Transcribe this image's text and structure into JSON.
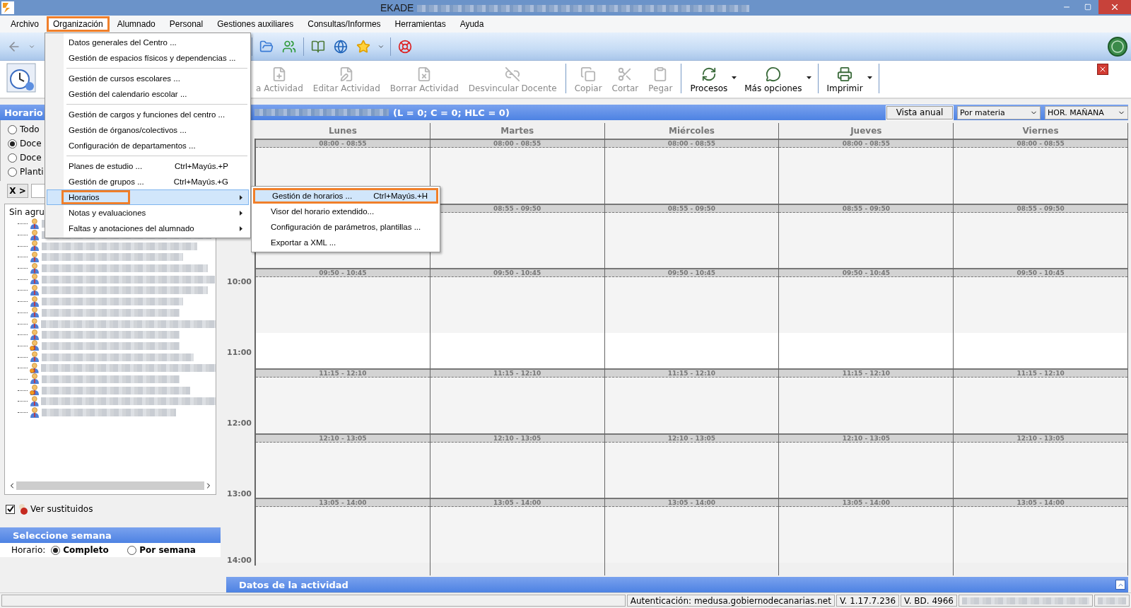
{
  "window": {
    "title": "EKADE"
  },
  "menu_bar": [
    {
      "label": "Archivo",
      "selected": false
    },
    {
      "label": "Organización",
      "selected": true
    },
    {
      "label": "Alumnado",
      "selected": false
    },
    {
      "label": "Personal",
      "selected": false
    },
    {
      "label": "Gestiones auxiliares",
      "selected": false
    },
    {
      "label": "Consultas/Informes",
      "selected": false
    },
    {
      "label": "Herramientas",
      "selected": false
    },
    {
      "label": "Ayuda",
      "selected": false
    }
  ],
  "dropdown": {
    "groups": [
      [
        {
          "label": "Datos generales del Centro ...",
          "selected": false,
          "outlined": false,
          "submenu": false
        },
        {
          "label": "Gestión de espacios físicos y dependencias ...",
          "selected": false,
          "outlined": false,
          "submenu": false
        }
      ],
      [
        {
          "label": "Gestión de cursos escolares ...",
          "selected": false,
          "outlined": false,
          "submenu": false
        },
        {
          "label": "Gestión del calendario escolar ...",
          "selected": false,
          "outlined": false,
          "submenu": false
        }
      ],
      [
        {
          "label": "Gestión de cargos y funciones del centro ...",
          "selected": false,
          "outlined": false,
          "submenu": false
        },
        {
          "label": "Gestión de órganos/colectivos ...",
          "selected": false,
          "outlined": false,
          "submenu": false
        },
        {
          "label": "Configuración de departamentos ...",
          "selected": false,
          "outlined": false,
          "submenu": false
        }
      ],
      [
        {
          "label": "Planes de estudio ...",
          "shortcut": "Ctrl+Mayús.+P",
          "selected": false,
          "outlined": false,
          "submenu": false
        },
        {
          "label": "Gestión de grupos ...",
          "shortcut": "Ctrl+Mayús.+G",
          "selected": false,
          "outlined": false,
          "submenu": false
        },
        {
          "label": "Horarios",
          "selected": true,
          "outlined": true,
          "submenu": true
        },
        {
          "label": "Notas y evaluaciones",
          "selected": false,
          "outlined": false,
          "submenu": true
        },
        {
          "label": "Faltas y anotaciones del alumnado",
          "selected": false,
          "outlined": false,
          "submenu": true
        }
      ]
    ]
  },
  "submenu": [
    {
      "label": "Gestión de horarios ...",
      "shortcut": "Ctrl+Mayús.+H",
      "selected": true,
      "outlined": true
    },
    {
      "label": "Visor del horario extendido...",
      "selected": false,
      "outlined": false
    },
    {
      "label": "Configuración de parámetros, plantillas ...",
      "selected": false,
      "outlined": false
    },
    {
      "label": "Exportar a XML ...",
      "selected": false,
      "outlined": false
    }
  ],
  "ribbon": {
    "groups": [
      [
        {
          "label": "a Actividad",
          "disabled": true,
          "dropdown": false
        },
        {
          "label": "Editar Actividad",
          "disabled": true,
          "dropdown": false
        },
        {
          "label": "Borrar Actividad",
          "disabled": true,
          "dropdown": false
        },
        {
          "label": "Desvincular Docente",
          "disabled": true,
          "dropdown": false
        }
      ],
      [
        {
          "label": "Copiar",
          "disabled": true,
          "dropdown": false
        },
        {
          "label": "Cortar",
          "disabled": true,
          "dropdown": false
        },
        {
          "label": "Pegar",
          "disabled": true,
          "dropdown": false
        }
      ],
      [
        {
          "label": "Procesos",
          "disabled": false,
          "dropdown": true
        },
        {
          "label": "Más opciones",
          "disabled": false,
          "dropdown": true
        }
      ],
      [
        {
          "label": "Imprimir",
          "disabled": false,
          "dropdown": true
        }
      ]
    ]
  },
  "left_panel": {
    "title": "Horario",
    "radios": [
      {
        "label": "Todo",
        "selected": false
      },
      {
        "label": "Doce",
        "selected": true
      },
      {
        "label": "Doce",
        "selected": false
      },
      {
        "label": "Planti",
        "selected": false
      }
    ],
    "filter_button": "X >",
    "tree_root": "Sin agru",
    "tree_items": [
      {
        "kind": "teacher"
      },
      {
        "kind": "teacher"
      },
      {
        "kind": "teacher"
      },
      {
        "kind": "teacher"
      },
      {
        "kind": "teacher"
      },
      {
        "kind": "teacher"
      },
      {
        "kind": "teacher"
      },
      {
        "kind": "teacher"
      },
      {
        "kind": "teacher"
      },
      {
        "kind": "teacher"
      },
      {
        "kind": "teacher"
      },
      {
        "kind": "marked"
      },
      {
        "kind": "teacher"
      },
      {
        "kind": "marked"
      },
      {
        "kind": "teacher"
      },
      {
        "kind": "marked"
      },
      {
        "kind": "teacher"
      },
      {
        "kind": "teacher"
      }
    ],
    "show_substitutes": {
      "label": "Ver sustituidos",
      "checked": true
    }
  },
  "week_panel": {
    "title": "Seleccione semana",
    "label": "Horario:",
    "options": [
      {
        "label": "Completo",
        "selected": true
      },
      {
        "label": "Por semana",
        "selected": false
      }
    ]
  },
  "schedule": {
    "counts": "(L = 0; C = 0; HLC = 0)",
    "annual_button": "Vista anual",
    "view_select": "Por materia",
    "timetable_select": "HOR. MAÑANA",
    "hours": [
      "10:00",
      "11:00",
      "12:00",
      "13:00",
      "14:00"
    ],
    "days": [
      {
        "label": "Lunes",
        "slots": [
          {
            "kind": "class",
            "label": "08:00 - 08:55"
          },
          {
            "kind": "class"
          },
          {
            "kind": "class",
            "label": "09:50 - 10:45"
          },
          {
            "kind": "break"
          },
          {
            "kind": "class",
            "label": "11:15 - 12:10"
          },
          {
            "kind": "class",
            "label": "12:10 - 13:05"
          },
          {
            "kind": "class",
            "label": "13:05 - 14:00"
          }
        ]
      },
      {
        "label": "Martes",
        "slots": [
          {
            "kind": "class",
            "label": "08:00 - 08:55"
          },
          {
            "kind": "class",
            "label": "08:55 - 09:50"
          },
          {
            "kind": "class",
            "label": "09:50 - 10:45"
          },
          {
            "kind": "break"
          },
          {
            "kind": "class",
            "label": "11:15 - 12:10"
          },
          {
            "kind": "class",
            "label": "12:10 - 13:05"
          },
          {
            "kind": "class",
            "label": "13:05 - 14:00"
          }
        ]
      },
      {
        "label": "Miércoles",
        "slots": [
          {
            "kind": "class",
            "label": "08:00 - 08:55"
          },
          {
            "kind": "class",
            "label": "08:55 - 09:50"
          },
          {
            "kind": "class",
            "label": "09:50 - 10:45"
          },
          {
            "kind": "break"
          },
          {
            "kind": "class",
            "label": "11:15 - 12:10"
          },
          {
            "kind": "class",
            "label": "12:10 - 13:05"
          },
          {
            "kind": "class",
            "label": "13:05 - 14:00"
          }
        ]
      },
      {
        "label": "Jueves",
        "slots": [
          {
            "kind": "class",
            "label": "08:00 - 08:55"
          },
          {
            "kind": "class",
            "label": "08:55 - 09:50"
          },
          {
            "kind": "class",
            "label": "09:50 - 10:45"
          },
          {
            "kind": "break"
          },
          {
            "kind": "class",
            "label": "11:15 - 12:10"
          },
          {
            "kind": "class",
            "label": "12:10 - 13:05"
          },
          {
            "kind": "class",
            "label": "13:05 - 14:00"
          }
        ]
      },
      {
        "label": "Viernes",
        "slots": [
          {
            "kind": "class",
            "label": "08:00 - 08:55"
          },
          {
            "kind": "class",
            "label": "08:55 - 09:50"
          },
          {
            "kind": "class",
            "label": "09:50 - 10:45"
          },
          {
            "kind": "break"
          },
          {
            "kind": "class",
            "label": "11:15 - 12:10"
          },
          {
            "kind": "class",
            "label": "12:10 - 13:05"
          },
          {
            "kind": "class",
            "label": "13:05 - 14:00"
          }
        ]
      }
    ]
  },
  "activity_panel": {
    "title": "Datos de la actividad"
  },
  "status_bar": [
    {
      "kind": "empty"
    },
    {
      "kind": "text",
      "text": "Autenticación: medusa.gobiernodecanarias.net"
    },
    {
      "kind": "text",
      "text": "V. 1.17.7.236"
    },
    {
      "kind": "text",
      "text": "V. BD. 4966"
    },
    {
      "kind": "redacted"
    },
    {
      "kind": "redacted"
    }
  ]
}
